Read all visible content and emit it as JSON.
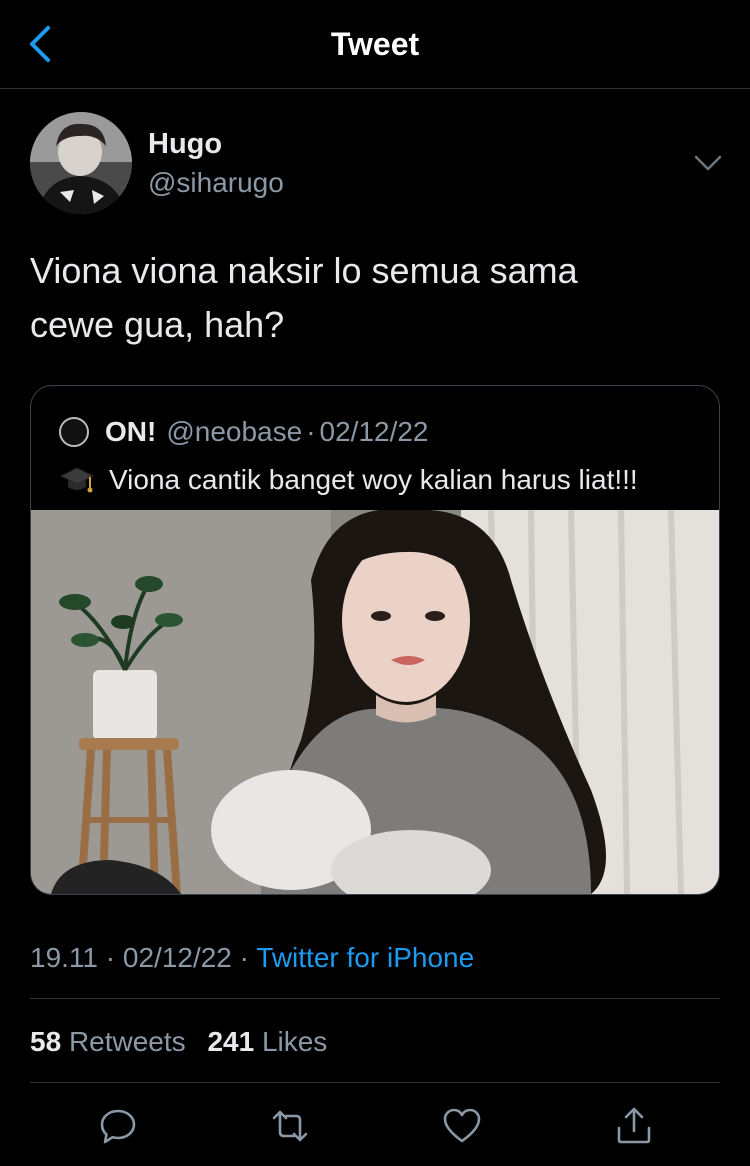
{
  "header": {
    "title": "Tweet",
    "back_icon": "chevron-left-icon"
  },
  "author": {
    "name": "Hugo",
    "handle": "@siharugo"
  },
  "tweet": {
    "text_line1": "Viona viona naksir lo semua sama",
    "text_line2": "cewe gua, hah?"
  },
  "quote": {
    "name": "ON!",
    "handle": "@neobase",
    "separator": "·",
    "date": "02/12/22",
    "text": "Viona cantik banget woy kalian harus liat!!!",
    "emoji_icon": "graduation-cap-icon"
  },
  "meta": {
    "time": "19.11",
    "separator": "·",
    "date": "02/12/22",
    "source": "Twitter for iPhone"
  },
  "stats": {
    "retweets_count": "58",
    "retweets_label": "Retweets",
    "likes_count": "241",
    "likes_label": "Likes"
  },
  "actions": {
    "reply_icon": "reply-icon",
    "retweet_icon": "retweet-icon",
    "like_icon": "heart-icon",
    "share_icon": "share-icon"
  },
  "colors": {
    "background": "#000000",
    "accent": "#1d9bf0",
    "text_primary": "#e7e9ea",
    "text_secondary": "#8b98a5",
    "border": "#2f3336"
  }
}
